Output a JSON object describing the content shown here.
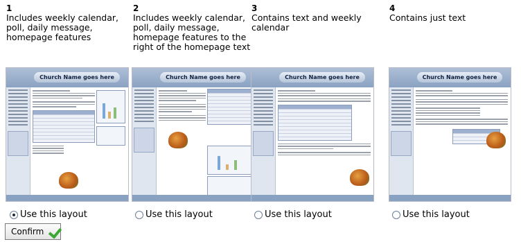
{
  "layouts": [
    {
      "number": "1",
      "description": "Includes weekly calendar, poll, daily message, homepage features",
      "site_title": "Church Name goes here",
      "option_label": "Use this layout",
      "selected": true
    },
    {
      "number": "2",
      "description": "Includes weekly calendar, poll, daily message, homepage features to the right of the homepage text",
      "site_title": "Church Name goes here",
      "option_label": "Use this layout",
      "selected": false
    },
    {
      "number": "3",
      "description": "Contains text and weekly calendar",
      "site_title": "Church Name goes here",
      "option_label": "Use this layout",
      "selected": false
    },
    {
      "number": "4",
      "description": "Contains just text",
      "site_title": "Church Name goes here",
      "option_label": "Use this layout",
      "selected": false
    }
  ],
  "confirm": {
    "label": "Confirm"
  },
  "icons": {
    "confirm": "checkmark-icon",
    "radio": "radio-icon"
  },
  "colors": {
    "accent": "#8aa2c2",
    "check": "#3aa833"
  }
}
